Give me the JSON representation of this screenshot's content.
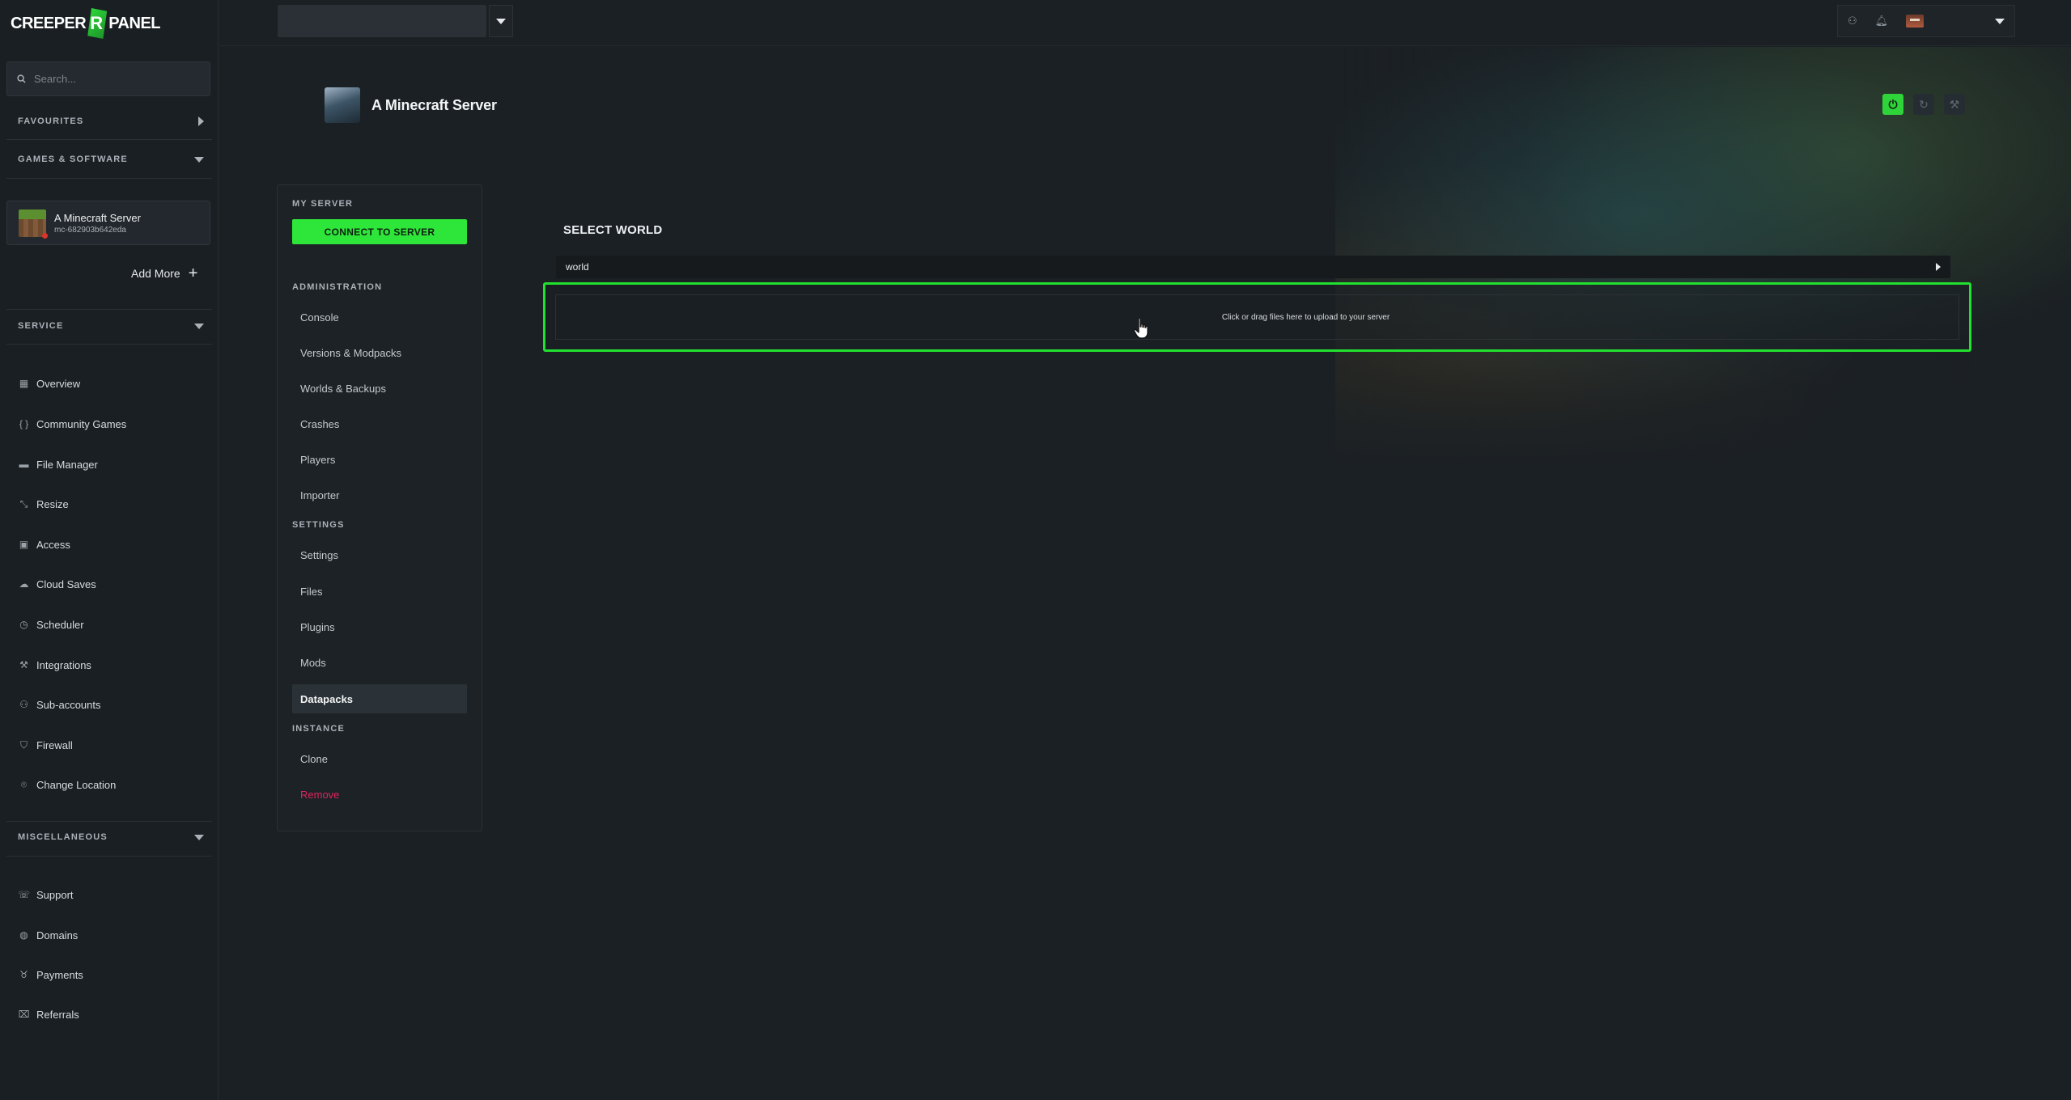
{
  "brand": {
    "logo_left": "CREEPER",
    "logo_mark": "R",
    "logo_right": "PANEL"
  },
  "search": {
    "placeholder": "Search..."
  },
  "sidebar": {
    "favourites": "FAVOURITES",
    "games_software": "GAMES & SOFTWARE",
    "server_card": {
      "name": "A Minecraft Server",
      "id": "mc-682903b642eda"
    },
    "add_more": "Add More",
    "service": "SERVICE",
    "service_items": [
      {
        "label": "Overview",
        "icon": "grid-icon"
      },
      {
        "label": "Community Games",
        "icon": "braces-icon"
      },
      {
        "label": "File Manager",
        "icon": "folder-icon"
      },
      {
        "label": "Resize",
        "icon": "resize-icon"
      },
      {
        "label": "Access",
        "icon": "lock-icon"
      },
      {
        "label": "Cloud Saves",
        "icon": "cloud-icon"
      },
      {
        "label": "Scheduler",
        "icon": "clock-icon"
      },
      {
        "label": "Integrations",
        "icon": "wrench-icon"
      },
      {
        "label": "Sub-accounts",
        "icon": "users-icon"
      },
      {
        "label": "Firewall",
        "icon": "shield-icon"
      },
      {
        "label": "Change Location",
        "icon": "location-pin-icon"
      }
    ],
    "misc": "MISCELLANEOUS",
    "misc_items": [
      {
        "label": "Support",
        "icon": "support-icon"
      },
      {
        "label": "Domains",
        "icon": "globe-icon"
      },
      {
        "label": "Payments",
        "icon": "piggy-bank-icon"
      },
      {
        "label": "Referrals",
        "icon": "gift-icon"
      }
    ]
  },
  "header": {
    "title": "A Minecraft Server"
  },
  "subnav": {
    "my_server": "MY SERVER",
    "connect": "CONNECT TO SERVER",
    "administration": "ADMINISTRATION",
    "admin_items": [
      "Console",
      "Versions & Modpacks",
      "Worlds & Backups",
      "Crashes",
      "Players",
      "Importer"
    ],
    "settings": "SETTINGS",
    "settings_items": [
      "Settings",
      "Files",
      "Plugins",
      "Mods",
      "Datapacks"
    ],
    "active_item": "Datapacks",
    "instance": "INSTANCE",
    "instance_items": [
      "Clone",
      "Remove"
    ]
  },
  "main": {
    "select_world_title": "SELECT WORLD",
    "world_value": "world",
    "dropzone_text": "Click or drag files here to upload to your server"
  },
  "colors": {
    "accent": "#2ee63a",
    "danger": "#e0245e",
    "background": "#1b2024"
  }
}
